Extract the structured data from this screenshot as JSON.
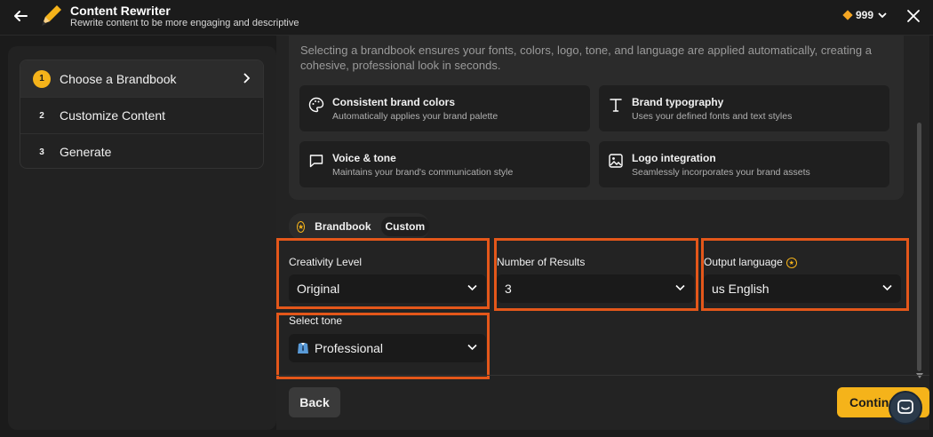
{
  "header": {
    "title": "Content Rewriter",
    "subtitle": "Rewrite content to be more engaging and descriptive",
    "credits": "999",
    "back_icon": "arrow-left-icon",
    "close_icon": "close-icon"
  },
  "steps": [
    {
      "number": "1",
      "label": "Choose a Brandbook",
      "active": true
    },
    {
      "number": "2",
      "label": "Customize Content",
      "active": false
    },
    {
      "number": "3",
      "label": "Generate",
      "active": false
    }
  ],
  "info": {
    "intro": "Selecting a brandbook ensures your fonts, colors, logo, tone, and language are applied automatically, creating a cohesive, professional look in seconds.",
    "features": [
      {
        "title": "Consistent brand colors",
        "description": "Automatically applies your brand palette",
        "icon": "palette-icon"
      },
      {
        "title": "Brand typography",
        "description": "Uses your defined fonts and text styles",
        "icon": "typography-icon"
      },
      {
        "title": "Voice & tone",
        "description": "Maintains your brand's communication style",
        "icon": "chat-icon"
      },
      {
        "title": "Logo integration",
        "description": "Seamlessly incorporates your brand assets",
        "icon": "image-icon"
      }
    ]
  },
  "mode_toggle": {
    "brandbook": "Brandbook",
    "custom": "Custom",
    "selected": "Custom"
  },
  "form": {
    "creativity": {
      "label": "Creativity Level",
      "value": "Original"
    },
    "results": {
      "label": "Number of Results",
      "value": "3"
    },
    "language": {
      "label": "Output language",
      "value": "us English"
    },
    "tone": {
      "label": "Select tone",
      "value": "Professional"
    }
  },
  "footer": {
    "back": "Back",
    "continue": "Continue"
  },
  "colors": {
    "accent": "#f5b31a",
    "highlight": "#e4571a"
  }
}
